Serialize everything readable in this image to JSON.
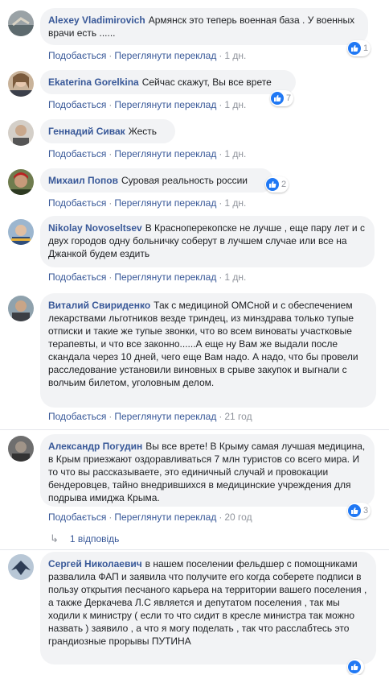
{
  "actions": {
    "like": "Подобається",
    "translate": "Переглянути переклад"
  },
  "comments": [
    {
      "author": "Alexey Vladimirovich",
      "text": "Армянск это теперь военная база . У военных врачи есть ......",
      "time": "1 дн.",
      "likes": "1"
    },
    {
      "author": "Ekaterina Gorelkina",
      "text": "Сейчас скажут, Вы все врете",
      "time": "1 дн.",
      "likes": "7"
    },
    {
      "author": "Геннадий Сивак",
      "text": "Жесть",
      "time": "1 дн.",
      "likes": ""
    },
    {
      "author": "Михаил Попов",
      "text": "Суровая реальность россии",
      "time": "1 дн.",
      "likes": "2"
    },
    {
      "author": "Nikolay Novoseltsev",
      "text": "В Красноперекопске не лучше , еще пару лет и с двух городов одну больничку соберут в лучшем случае или все на Джанкой будем ездить",
      "time": "1 дн.",
      "likes": ""
    },
    {
      "author": "Виталий Свириденко",
      "text": "Так с медициной ОМСной и с обеспечением лекарствами льготников везде триндец, из минздрава только тупые отписки и такие же тупые звонки, что во всем виноваты участковые терапевты, и что все законно......А еще ну Вам же выдали после скандала через 10 дней, чего еще Вам надо. А надо, что бы провели расследование установили виновных в срыве закупок и выгнали с волчьим билетом, уголовным делом.",
      "time": "21 год",
      "likes": ""
    },
    {
      "author": "Александр Погудин",
      "text": "Вы все врете! В Крыму самая лучшая медицина, в Крым приезжают оздоравливаться 7 млн туристов со всего мира. И то что вы рассказываете, это единичный случай и провокации бендеровцев, тайно внедрившихся в медицинские учреждения для подрыва имиджа Крыма.",
      "time": "20 год",
      "likes": "3"
    },
    {
      "author": "Сергей Николаевич",
      "text": "в нашем поселении фельдшер с помощниками развалила ФАП и заявила что получите его когда соберете подписи в пользу открытия песчаного карьера на территории вашего поселения , а также Деркачева Л.С является и депутатом поселения , так мы ходили к министру ( если то что сидит в кресле министра так можно назвать ) заявило , а что я могу поделать , так что расслабтесь это грандиозные прорывы ПУТИНА",
      "time": "",
      "likes": ""
    }
  ],
  "replies_label": "1 відповідь",
  "colors": {
    "link": "#385898",
    "bubble": "#f2f3f5",
    "like": "#2078f4",
    "muted": "#90949c"
  }
}
